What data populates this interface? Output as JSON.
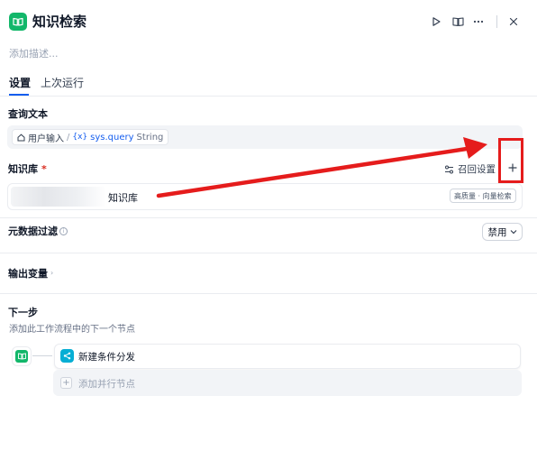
{
  "header": {
    "title": "知识检索",
    "app_icon": "book-open-icon",
    "actions": [
      "run-icon",
      "book-icon",
      "more-icon",
      "close-icon"
    ],
    "description_placeholder": "添加描述..."
  },
  "tabs": [
    {
      "label": "设置",
      "active": true
    },
    {
      "label": "上次运行",
      "active": false
    }
  ],
  "query": {
    "label": "查询文本",
    "variable": {
      "source_icon": "home-icon",
      "source": "用户输入",
      "separator": "/",
      "var_prefix": "{x}",
      "name": "sys.query",
      "type": "String"
    }
  },
  "knowledge": {
    "label": "知识库",
    "required_mark": "*",
    "recall_label": "召回设置",
    "add_icon": "plus-icon",
    "items": [
      {
        "name": "知识库",
        "badge": "高质量 · 向量检索"
      }
    ]
  },
  "metadata_filter": {
    "label": "元数据过滤",
    "info_icon": "info-icon",
    "value": "禁用"
  },
  "output": {
    "label": "输出变量",
    "expand_icon": "chevron-right-icon"
  },
  "next_step": {
    "title": "下一步",
    "subtitle": "添加此工作流程中的下一个节点",
    "next_node_label": "新建条件分发",
    "add_parallel_label": "添加并行节点"
  },
  "colors": {
    "accent": "#155eef",
    "node_green": "#12b76a",
    "branch_blue": "#06aed4",
    "annotation_red": "#e51c1c"
  }
}
